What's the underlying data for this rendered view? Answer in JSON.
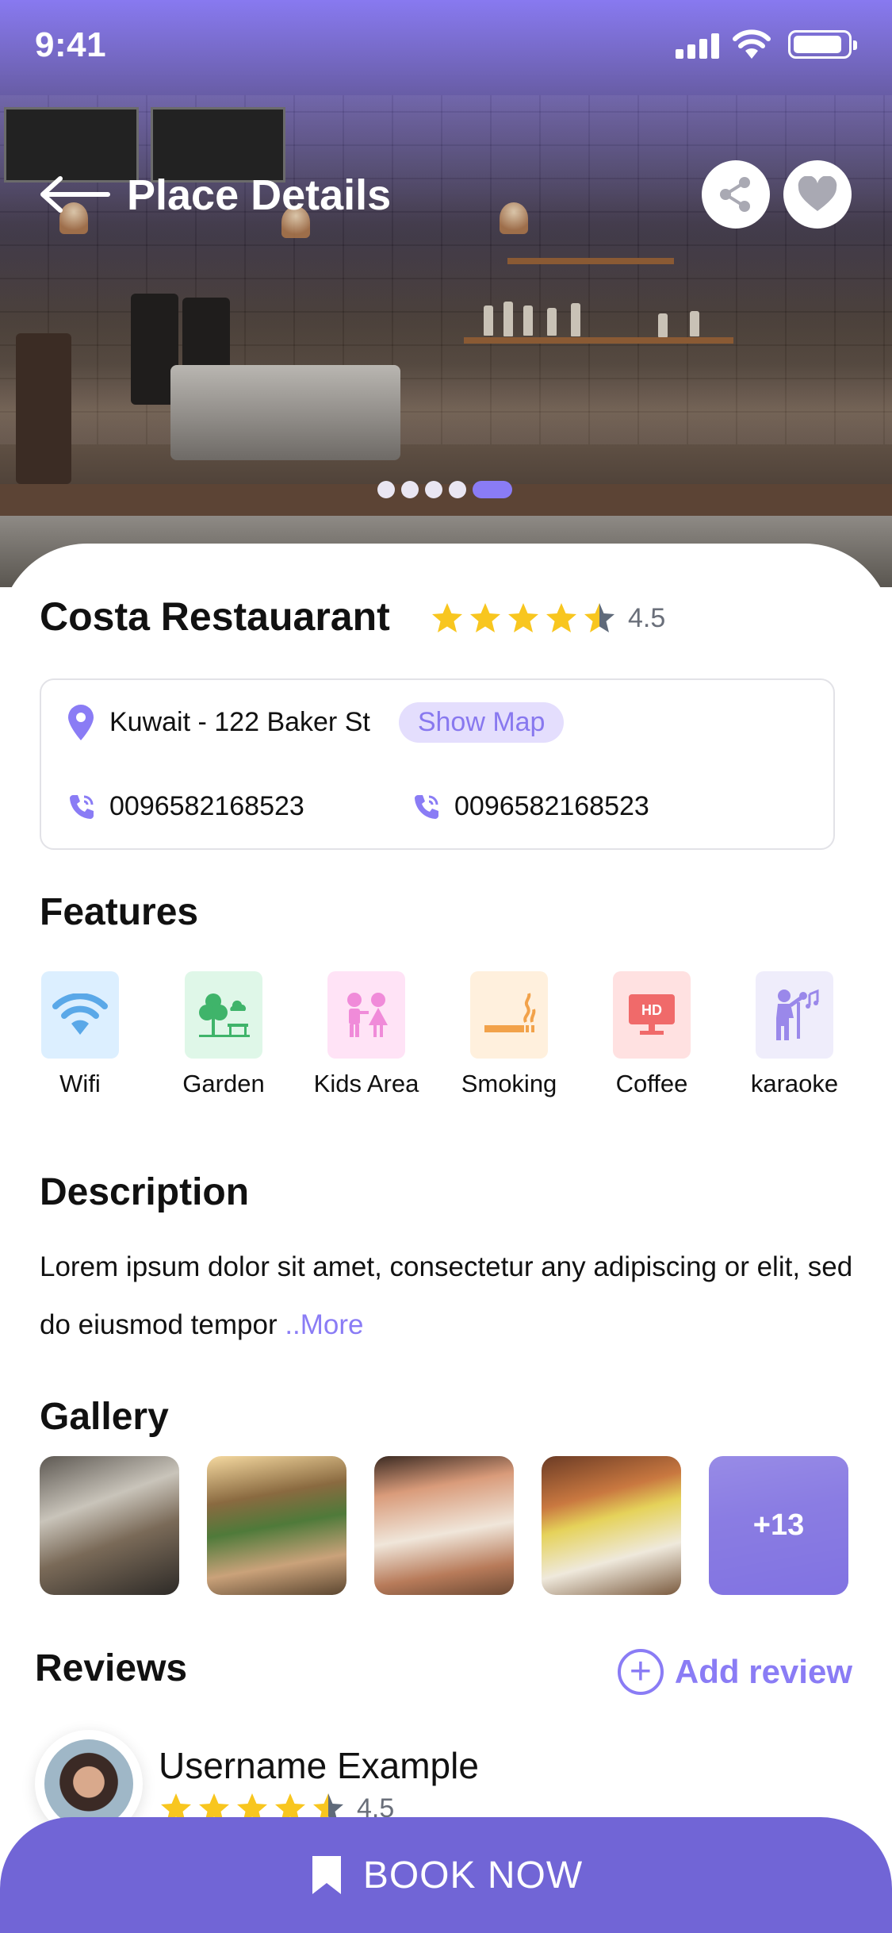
{
  "status_bar": {
    "time": "9:41"
  },
  "header": {
    "title": "Place Details"
  },
  "carousel": {
    "dot_count": 5,
    "active_index": 4
  },
  "place": {
    "name": "Costa Restauarant",
    "rating": 4.5,
    "rating_text": "4.5",
    "address": "Kuwait - 122 Baker St",
    "show_map_label": "Show Map",
    "phone_1": "0096582168523",
    "phone_2": "0096582168523"
  },
  "features": {
    "heading": "Features",
    "items": [
      {
        "label": "Wifi",
        "icon": "wifi-icon",
        "tile_color": "#dcefff"
      },
      {
        "label": "Garden",
        "icon": "garden-icon",
        "tile_color": "#dff7e8"
      },
      {
        "label": "Kids Area",
        "icon": "kids-area-icon",
        "tile_color": "#ffe3f6"
      },
      {
        "label": "Smoking",
        "icon": "smoking-icon",
        "tile_color": "#fff0dd"
      },
      {
        "label": "Coffee",
        "icon": "tv-hd-icon",
        "tile_color": "#ffe1e1"
      },
      {
        "label": "karaoke",
        "icon": "karaoke-icon",
        "tile_color": "#efedfb"
      }
    ]
  },
  "description": {
    "heading": "Description",
    "text": "Lorem ipsum dolor sit amet, consectetur any adipiscing or elit, sed do eiusmod tempor ",
    "more_label": "..More"
  },
  "gallery": {
    "heading": "Gallery",
    "more_count": "+13"
  },
  "reviews": {
    "heading": "Reviews",
    "add_label": "Add review",
    "items": [
      {
        "username": "Username Example",
        "rating": 4.5,
        "rating_text": "4.5"
      }
    ]
  },
  "cta": {
    "label": "BOOK NOW"
  },
  "colors": {
    "accent": "#8a7cf5",
    "cta": "#7165d6",
    "star": "#f8c61f",
    "star_half": "#5f6a7a"
  }
}
